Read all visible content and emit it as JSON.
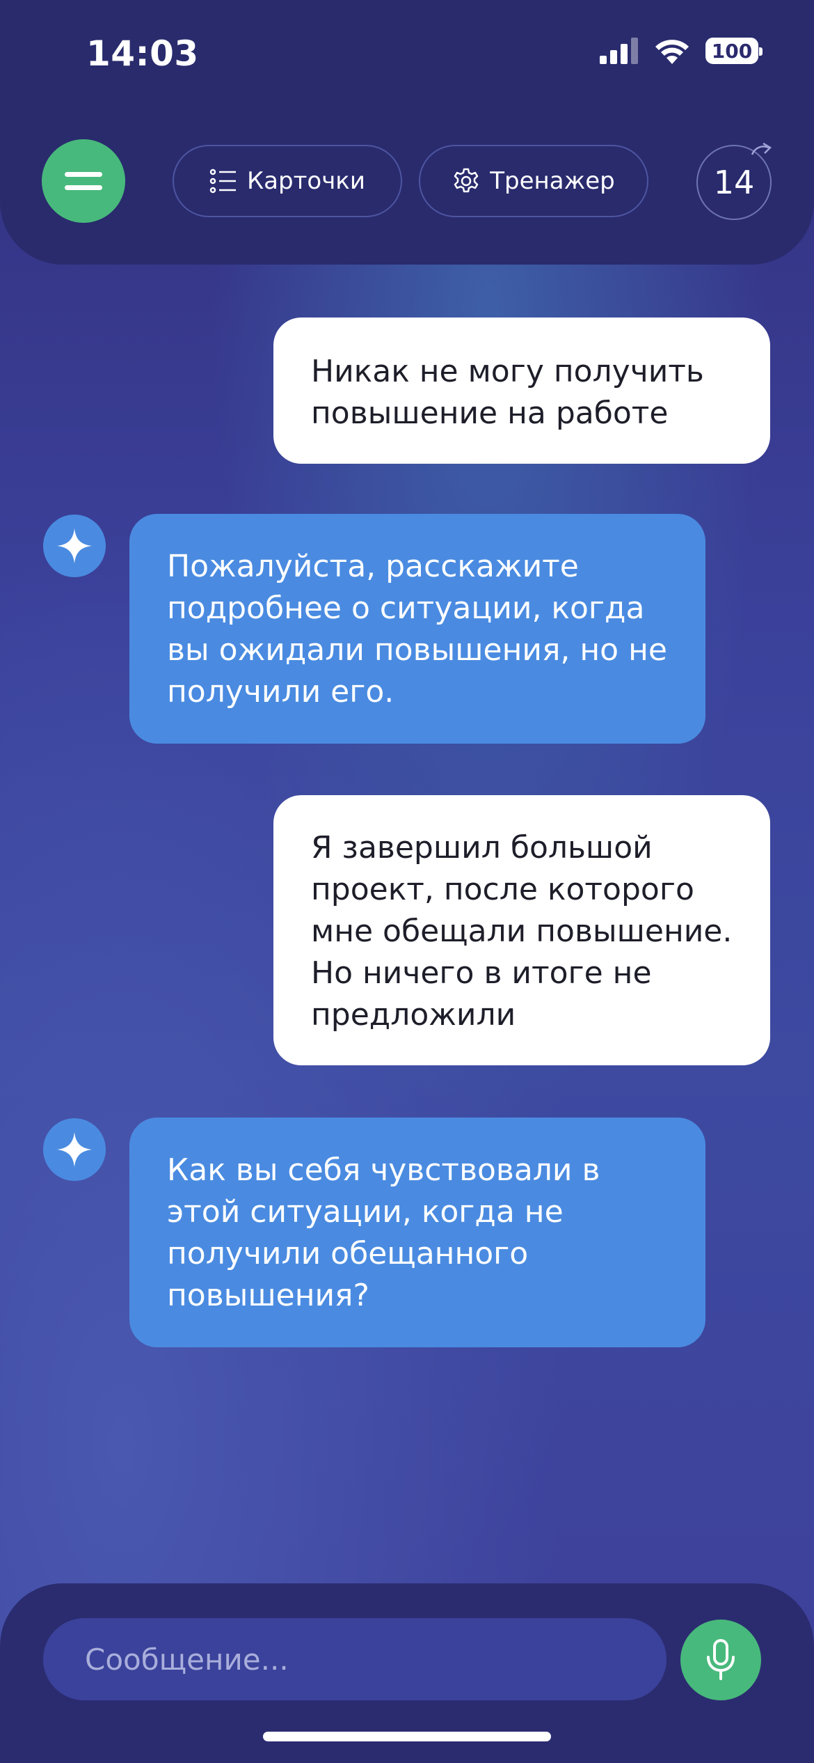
{
  "status": {
    "time": "14:03",
    "battery": "100"
  },
  "header": {
    "cards_label": "Карточки",
    "trainer_label": "Тренажер",
    "counter": "14"
  },
  "messages": [
    {
      "role": "user",
      "text": "Никак не могу получить повышение на работе"
    },
    {
      "role": "bot",
      "text": "Пожалуйста, расскажите подробнее о ситуации, когда вы ожидали повышения, но не получили его."
    },
    {
      "role": "user",
      "text": "Я завершил большой проект, после которого мне обещали повышение. Но ничего в итоге не предложили"
    },
    {
      "role": "bot",
      "text": "Как вы себя чувствовали в этой ситуации, когда не получили обещанного повышения?"
    }
  ],
  "composer": {
    "placeholder": "Сообщение..."
  },
  "colors": {
    "accent_green": "#48b97c",
    "bot_bubble": "#4a8be1",
    "header_bg": "#292b6d"
  }
}
